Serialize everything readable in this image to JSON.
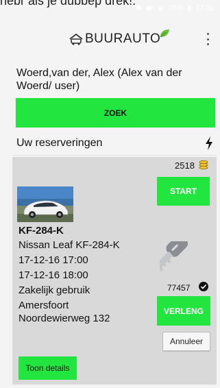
{
  "top_text": "nebr als je dubbep drek!.",
  "status_bar": {
    "battery": "73%",
    "time": "17:02"
  },
  "header": {
    "logo_text": "BUURAUTO",
    "menu_icon": "more-vertical-icon"
  },
  "user": {
    "name": "Woerd,van der, Alex (Alex van der Woerd/ user)"
  },
  "search": {
    "button_label": "ZOEK"
  },
  "reservations": {
    "title": "Uw reserveringen",
    "icon": "bolt-icon"
  },
  "reservation": {
    "credits": "2518",
    "start_label": "START",
    "plate": "KF-284-K",
    "lines": [
      "Nissan Leaf KF-284-K",
      "17-12-16 17:00",
      "17-12-16 18:00",
      "Zakelijk gebruik",
      "Amersfoort",
      "Noordewierweg 132"
    ],
    "key_code": "77457",
    "extend_label": "VERLENG",
    "cancel_label": "Annuleer",
    "details_label": "Toon details"
  },
  "colors": {
    "accent_green": "#22e53f",
    "card_bg": "#d9d9d9",
    "page_bg": "#f4f4f4"
  }
}
